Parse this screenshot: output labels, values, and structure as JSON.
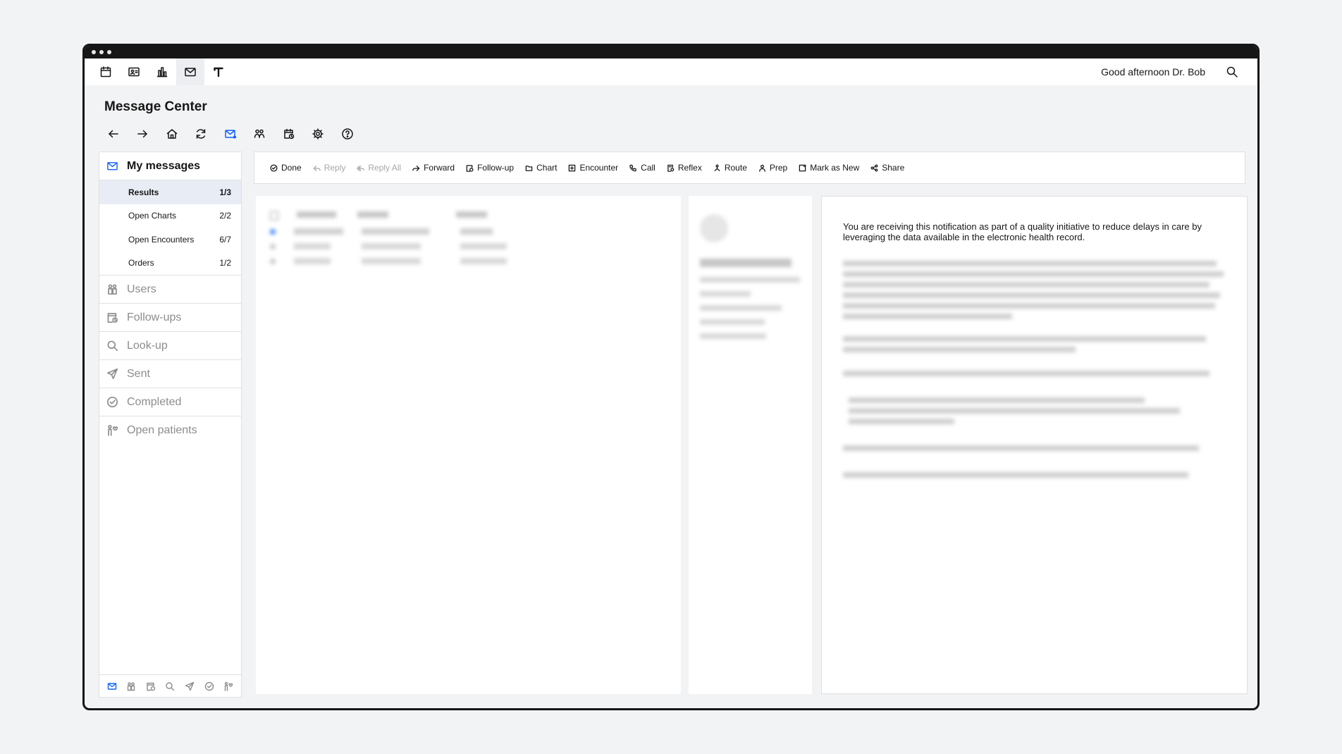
{
  "window": {
    "greeting": "Good afternoon Dr. Bob",
    "page_title": "Message Center"
  },
  "topnav": {
    "icons": [
      "calendar-icon",
      "id-card-icon",
      "bar-chart-icon",
      "mail-icon",
      "text-icon"
    ],
    "active": "mail-icon"
  },
  "toolbar_icons": [
    "arrow-left-icon",
    "arrow-right-icon",
    "home-icon",
    "refresh-icon",
    "mail-unread-icon",
    "group-icon",
    "calendar-clock-icon",
    "gear-icon",
    "help-icon"
  ],
  "sidebar": {
    "header": "My messages",
    "subitems": [
      {
        "label": "Results",
        "count": "1/3"
      },
      {
        "label": "Open Charts",
        "count": "2/2"
      },
      {
        "label": "Open Encounters",
        "count": "6/7"
      },
      {
        "label": "Orders",
        "count": "1/2"
      }
    ],
    "items": [
      {
        "label": "Users",
        "icon": "users-icon"
      },
      {
        "label": "Follow-ups",
        "icon": "follow-up-icon"
      },
      {
        "label": "Look-up",
        "icon": "search-icon"
      },
      {
        "label": "Sent",
        "icon": "send-icon"
      },
      {
        "label": "Completed",
        "icon": "checkmark-circle-icon"
      },
      {
        "label": "Open patients",
        "icon": "patients-icon"
      }
    ]
  },
  "actions": [
    {
      "label": "Done",
      "icon": "checkmark-circle-icon",
      "disabled": false
    },
    {
      "label": "Reply",
      "icon": "reply-icon",
      "disabled": true
    },
    {
      "label": "Reply All",
      "icon": "reply-all-icon",
      "disabled": true
    },
    {
      "label": "Forward",
      "icon": "forward-icon",
      "disabled": false
    },
    {
      "label": "Follow-up",
      "icon": "follow-up-icon",
      "disabled": false
    },
    {
      "label": "Chart",
      "icon": "folder-icon",
      "disabled": false
    },
    {
      "label": "Encounter",
      "icon": "encounter-icon",
      "disabled": false
    },
    {
      "label": "Call",
      "icon": "phone-icon",
      "disabled": false
    },
    {
      "label": "Reflex",
      "icon": "reflex-icon",
      "disabled": false
    },
    {
      "label": "Route",
      "icon": "route-icon",
      "disabled": false
    },
    {
      "label": "Prep",
      "icon": "person-icon",
      "disabled": false
    },
    {
      "label": "Mark as New",
      "icon": "mark-new-icon",
      "disabled": false
    },
    {
      "label": "Share",
      "icon": "share-icon",
      "disabled": false
    }
  ],
  "message": {
    "intro": "You are receiving this notification as part of a quality initiative to reduce delays in care by leveraging the data available in the electronic health record."
  }
}
